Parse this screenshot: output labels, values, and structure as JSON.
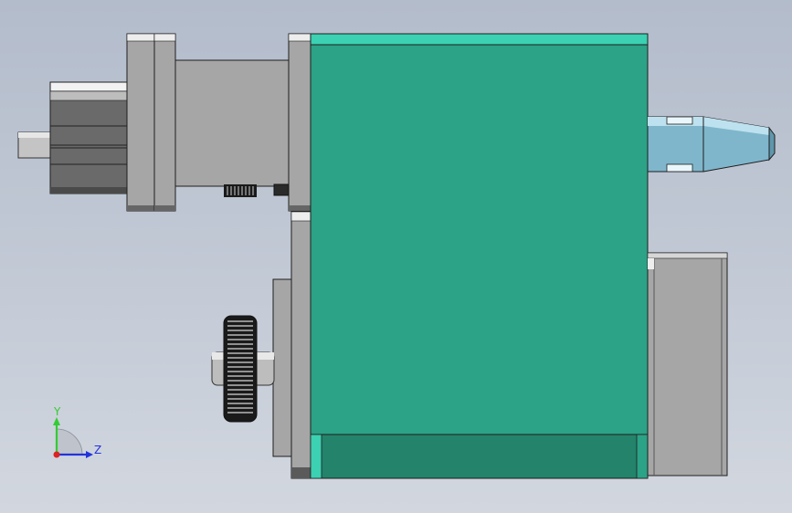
{
  "viewport": {
    "view": "cad-model-side-view",
    "background_top": "#b3bccb",
    "background_bottom": "#d2d7df"
  },
  "colors": {
    "housing": "#2ca286",
    "housing_dark": "#23836b",
    "housing_top": "#3bd1b2",
    "steel": "#a7a7a7",
    "steel_dark": "#6e6e6e",
    "motor_body": "#6a6a6a",
    "nozzle": "#7fb6cc",
    "gear": "#1a1a1a",
    "edge": "#1e1e1e"
  },
  "triad": {
    "y_label": "Y",
    "z_label": "Z",
    "y_color": "#33cc33",
    "z_color": "#2233dd",
    "x_color": "#dd2222"
  }
}
